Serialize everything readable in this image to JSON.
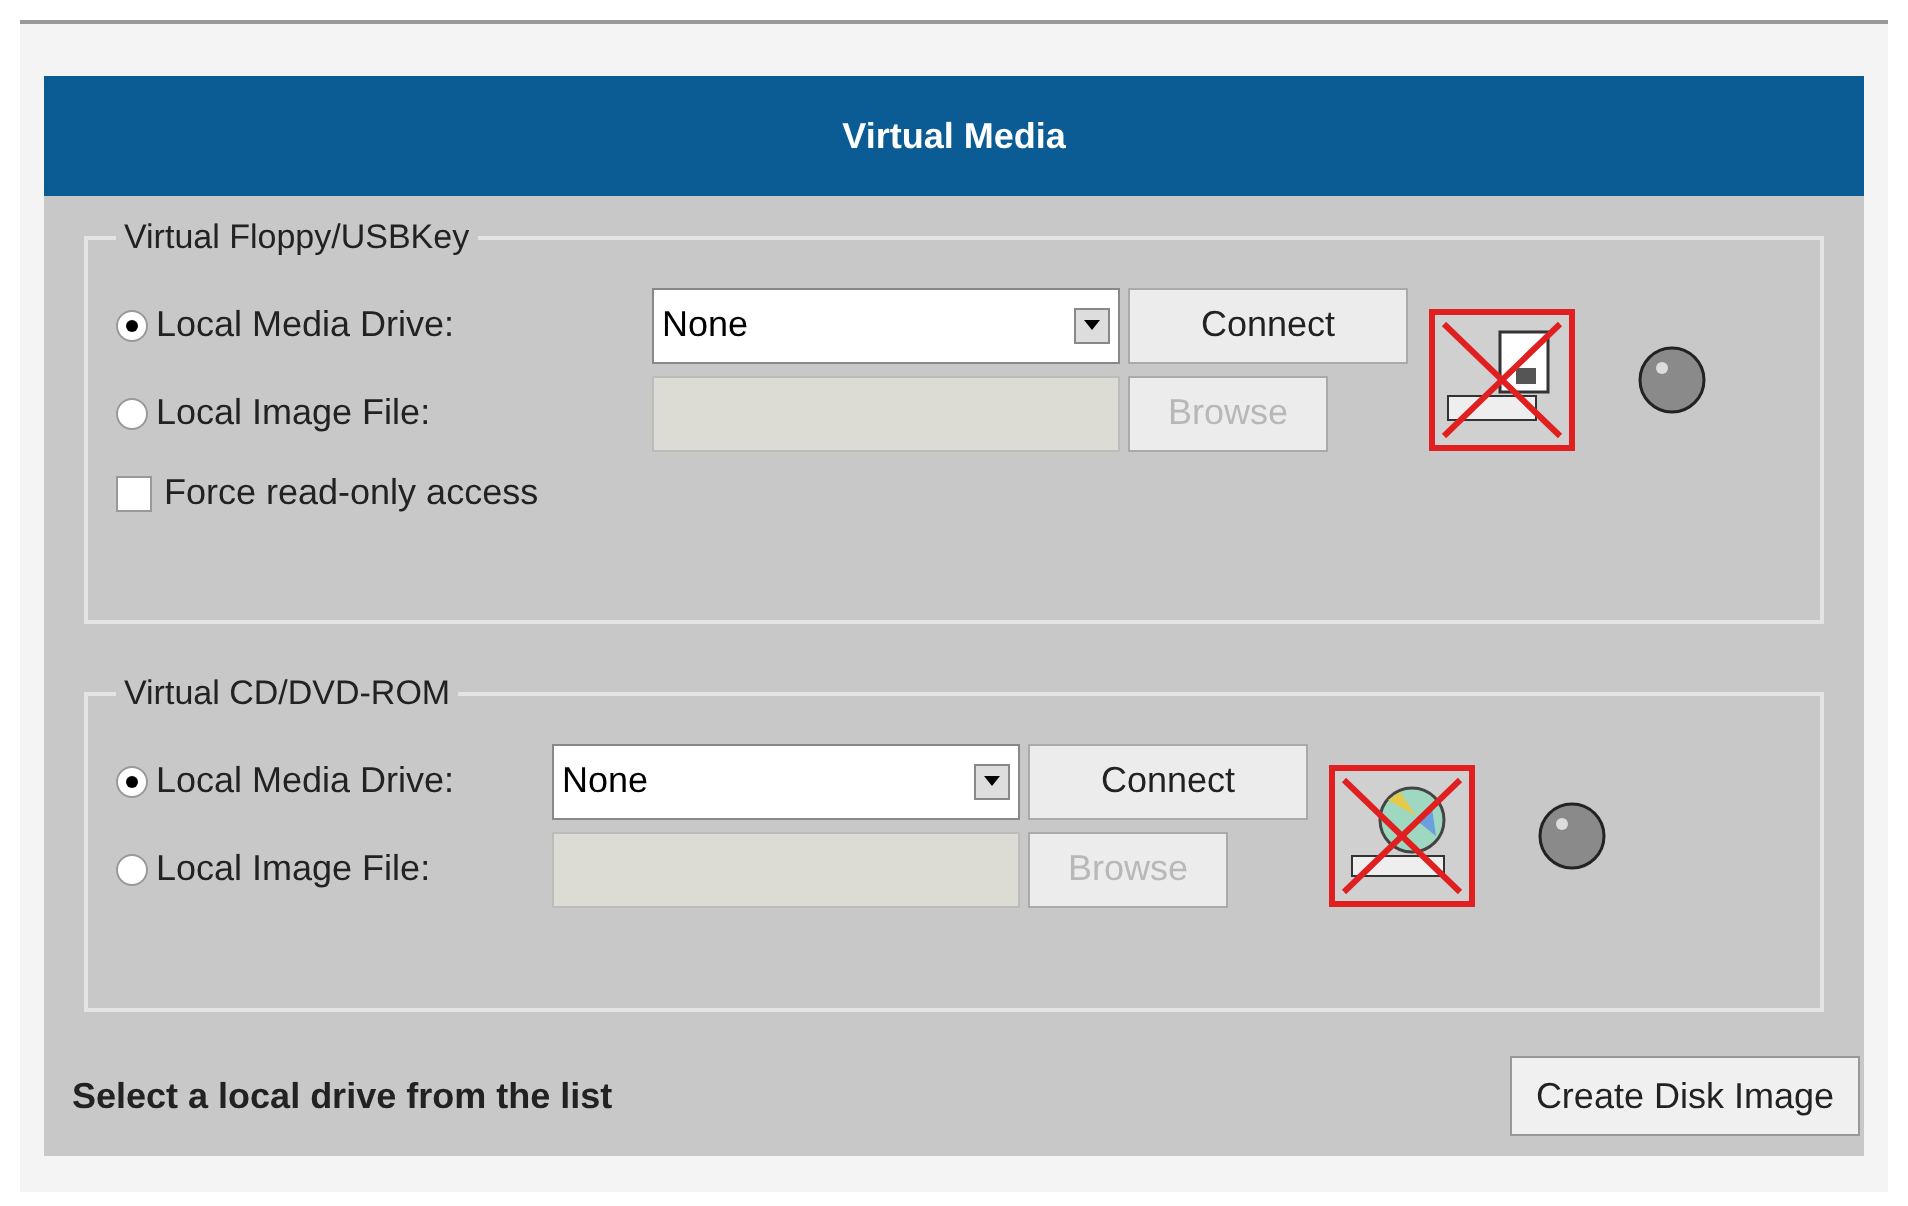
{
  "header": {
    "title": "Virtual Media"
  },
  "sections": [
    {
      "legend": "Virtual Floppy/USBKey",
      "kind": "floppy",
      "options": [
        {
          "label": "Local Media Drive:",
          "selected": true,
          "kind": "dropdown",
          "value": "None",
          "button": "Connect",
          "disabled": false
        },
        {
          "label": "Local Image File:",
          "selected": false,
          "kind": "file",
          "button": "Browse",
          "disabled": true
        }
      ],
      "checkbox": {
        "label": "Force read-only access",
        "checked": false
      },
      "connected": false
    },
    {
      "legend": "Virtual CD/DVD-ROM",
      "kind": "cd",
      "options": [
        {
          "label": "Local Media Drive:",
          "selected": true,
          "kind": "dropdown",
          "value": "None",
          "button": "Connect",
          "disabled": false
        },
        {
          "label": "Local Image File:",
          "selected": false,
          "kind": "file",
          "button": "Browse",
          "disabled": true
        }
      ],
      "connected": false
    }
  ],
  "footer": {
    "message": "Select a local drive from the list",
    "button": "Create Disk Image"
  }
}
